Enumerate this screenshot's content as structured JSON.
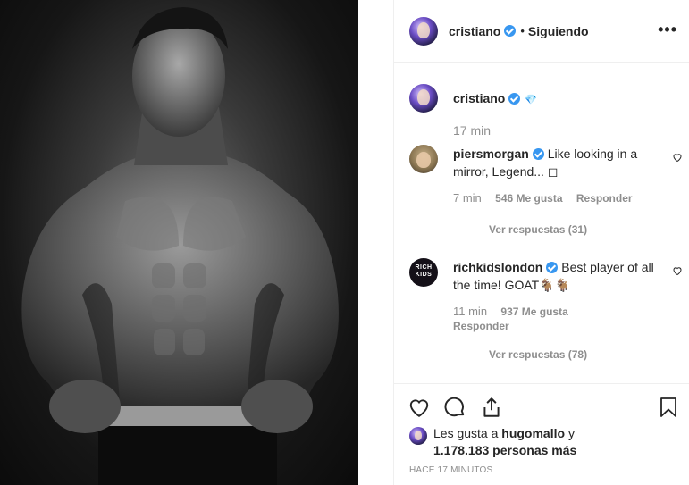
{
  "header": {
    "username": "cristiano",
    "follow_status": "Siguiendo",
    "separator": "•",
    "more_label": "•••"
  },
  "caption": {
    "username": "cristiano",
    "emoji": "💎",
    "time": "17 min"
  },
  "comments": [
    {
      "username": "piersmorgan",
      "text": "Like looking in a mirror, Legend... ◻",
      "time": "7 min",
      "likes": "546 Me gusta",
      "reply": "Responder",
      "view_replies": "Ver respuestas (31)"
    },
    {
      "username": "richkidslondon",
      "text": "Best player of all the time! GOAT🐐🐐",
      "time": "11 min",
      "likes": "937 Me gusta",
      "reply": "Responder",
      "view_replies": "Ver respuestas (78)",
      "avatar_text": "RICH KIDS"
    }
  ],
  "actions": {
    "icons": [
      "heart-icon",
      "comment-icon",
      "share-icon",
      "bookmark-icon"
    ]
  },
  "likes": {
    "prefix": "Les gusta a",
    "user": "hugomallo",
    "conj": "y",
    "count": "1.178.183 personas más"
  },
  "timestamp": "HACE 17 MINUTOS",
  "colors": {
    "verified": "#3897f0",
    "secondary_text": "#8e8e8e",
    "border": "#efefef"
  }
}
